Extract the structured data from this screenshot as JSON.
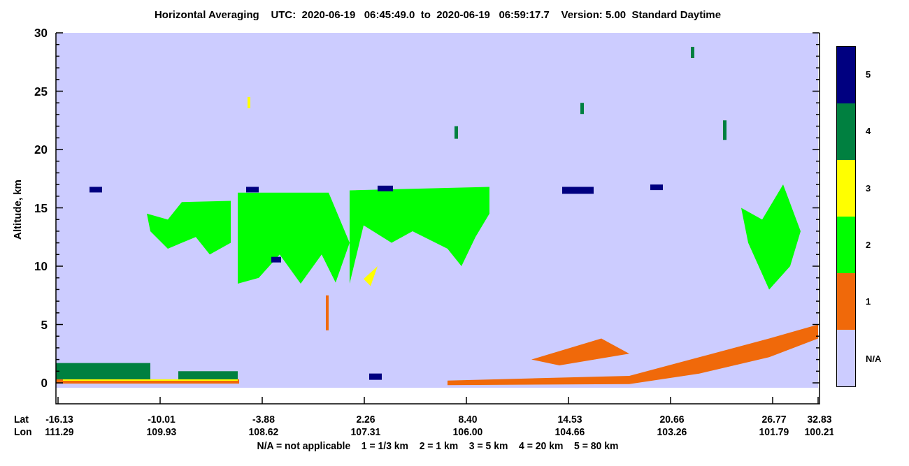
{
  "title": "Horizontal Averaging    UTC:  2020-06-19   06:45:49.0  to  2020-06-19   06:59:17.7    Version: 5.00  Standard Daytime",
  "y_axis": {
    "label": "Altitude, km",
    "ticks": [
      "30",
      "25",
      "20",
      "15",
      "10",
      "5",
      "0"
    ]
  },
  "x_axis": {
    "row_labels": [
      "Lat",
      "Lon"
    ],
    "ticks": [
      {
        "lat": "-16.13",
        "lon": "111.29"
      },
      {
        "lat": "-10.01",
        "lon": "109.93"
      },
      {
        "lat": "-3.88",
        "lon": "108.62"
      },
      {
        "lat": "2.26",
        "lon": "107.31"
      },
      {
        "lat": "8.40",
        "lon": "106.00"
      },
      {
        "lat": "14.53",
        "lon": "104.66"
      },
      {
        "lat": "20.66",
        "lon": "103.26"
      },
      {
        "lat": "26.77",
        "lon": "101.79"
      },
      {
        "lat": "32.83",
        "lon": "100.21"
      }
    ]
  },
  "colorbar": [
    {
      "label": "5",
      "color": "#000080"
    },
    {
      "label": "4",
      "color": "#008040"
    },
    {
      "label": "3",
      "color": "#ffff00"
    },
    {
      "label": "2",
      "color": "#00ff00"
    },
    {
      "label": "1",
      "color": "#f0690a"
    },
    {
      "label": "N/A",
      "color": "#ccccff"
    }
  ],
  "legend": "N/A = not applicable    1 = 1/3 km    2 = 1 km    3 = 5 km    4 = 20 km    5 = 80 km"
}
